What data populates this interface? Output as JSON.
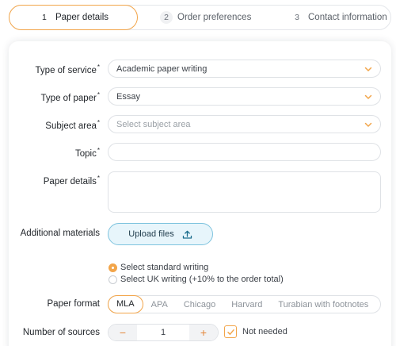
{
  "steps": [
    {
      "num": "1",
      "label": "Paper details"
    },
    {
      "num": "2",
      "label": "Order preferences"
    },
    {
      "num": "3",
      "label": "Contact information"
    }
  ],
  "form": {
    "type_of_service": {
      "label": "Type of service",
      "required_mark": "*",
      "value": "Academic paper writing"
    },
    "type_of_paper": {
      "label": "Type of paper",
      "required_mark": "*",
      "value": "Essay"
    },
    "subject_area": {
      "label": "Subject area",
      "required_mark": "*",
      "placeholder": "Select subject area"
    },
    "topic": {
      "label": "Topic",
      "required_mark": "*",
      "value": ""
    },
    "paper_details": {
      "label": "Paper details",
      "required_mark": "*",
      "value": ""
    },
    "additional_materials": {
      "label": "Additional materials",
      "upload_label": "Upload files"
    },
    "writing_options": [
      {
        "label": "Select standard writing",
        "selected": true
      },
      {
        "label": "Select UK writing (+10% to the order total)",
        "selected": false
      }
    ],
    "paper_format": {
      "label": "Paper format",
      "options": [
        "MLA",
        "APA",
        "Chicago",
        "Harvard",
        "Turabian with footnotes"
      ],
      "selected": "MLA"
    },
    "number_of_sources": {
      "label": "Number of sources",
      "minus": "−",
      "plus": "+",
      "value": "1",
      "not_needed_label": "Not needed",
      "not_needed_checked": true
    }
  },
  "colors": {
    "accent": "#f2a54a",
    "upload_border": "#7ec3de",
    "upload_bg": "#e7f5fb"
  }
}
